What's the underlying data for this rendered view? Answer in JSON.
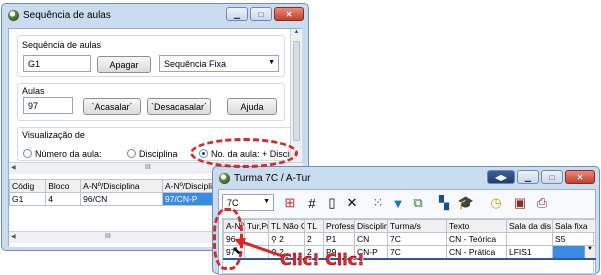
{
  "win1": {
    "title": "Sequência de aulas",
    "group_label": "Sequência de aulas",
    "seq_value": "G1",
    "delete_label": "Apagar",
    "seq_type": "Sequência Fixa",
    "aulas_label": "Aulas",
    "aulas_value": "97",
    "acasalar_label": "`Acasalar´",
    "desacasalar_label": "`Desacasalar´",
    "ajuda_label": "Ajuda",
    "vis_label": "Visualização de",
    "radio1": "Número da aula:",
    "radio2": "Disciplina",
    "radio3": "No. da aula: + Discipli",
    "hscroll_mark": "III",
    "table": {
      "headers": [
        "Códig",
        "Bloco",
        "A-Nº/Disciplina",
        "A-Nº/Disciplina",
        "A"
      ],
      "row": [
        "G1",
        "4",
        "96/CN",
        "97/CN-P",
        ""
      ]
    }
  },
  "win2": {
    "title": "Turma 7C / A-Tur",
    "class_value": "7C",
    "headers": [
      "A-Nº",
      "Tur,Pr",
      "TL Não C",
      "TL",
      "Profess",
      "Disciplin",
      "Turma/s",
      "Texto",
      "Sala da dis",
      "Sala fixa"
    ],
    "rows": [
      [
        "96",
        "",
        "2",
        "2",
        "P1",
        "CN",
        "7C",
        "CN - Teórica",
        "",
        "S5"
      ],
      [
        "97",
        "",
        "2",
        "2",
        "P9",
        "CN-P",
        "7C",
        "CN - Prática",
        "LFIS1",
        ""
      ]
    ]
  },
  "annotation": "Clic! Clic!",
  "icons": {
    "toolbar": [
      "new-table-icon",
      "grid-icon",
      "blank-page-icon",
      "delete-x-icon",
      "color-dots-icon",
      "filter-icon",
      "copy-icon",
      "layout-icon",
      "graduation-cap-icon",
      "clock-icon",
      "calendar-icon",
      "print-icon"
    ]
  },
  "colors": {
    "annotation": "#e3262d",
    "selection": "#3a8be3",
    "window_frame": "#c9dcf0"
  }
}
